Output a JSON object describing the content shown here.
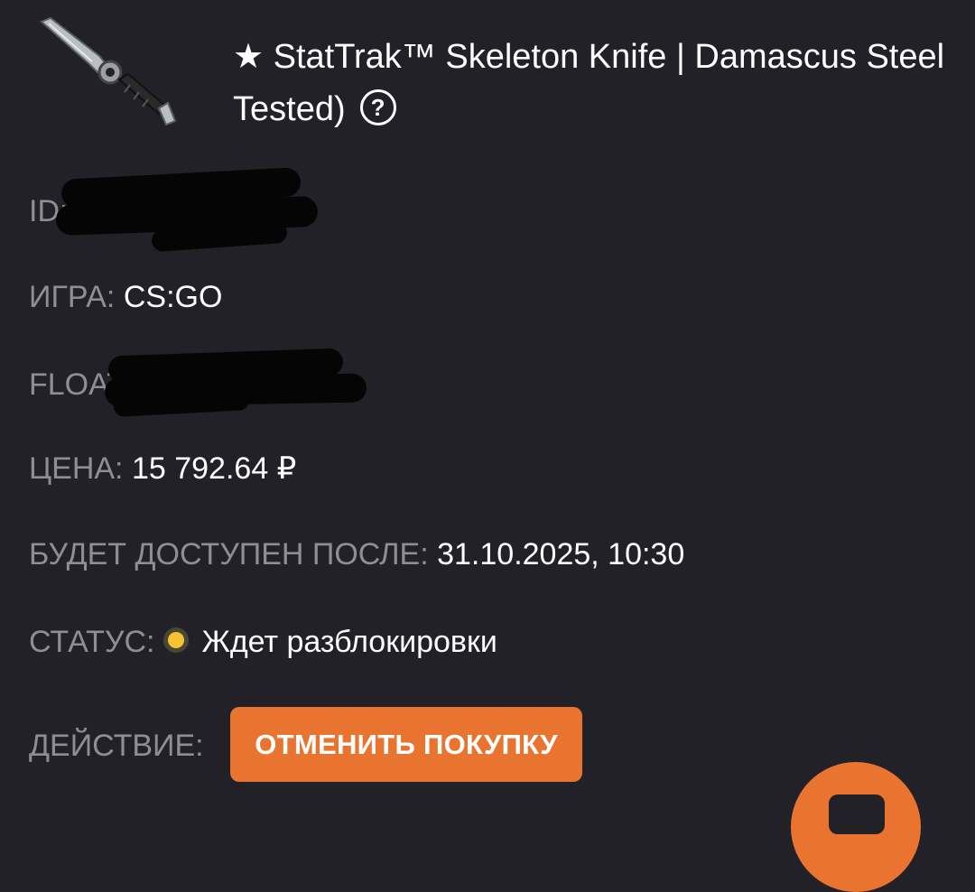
{
  "item": {
    "title_line1": "★ StatTrak™ Skeleton Knife | Damascus Steel",
    "title_line2": "Tested)",
    "help_icon_glyph": "?",
    "image_icon": "knife-image"
  },
  "details": {
    "id_label": "ID:",
    "game_label": "ИГРА:",
    "game_value": "CS:GO",
    "float_label": "FLOAT:",
    "price_label": "ЦЕНА:",
    "price_value": "15 792.64 ₽",
    "available_label": "БУДЕТ ДОСТУПЕН ПОСЛЕ:",
    "available_value": "31.10.2025, 10:30",
    "status_label": "СТАТУС:",
    "status_value": "Ждет разблокировки",
    "status_color": "#f6c232",
    "action_label": "ДЕЙСТВИЕ:",
    "action_button": "ОТМЕНИТЬ ПОКУПКУ"
  },
  "colors": {
    "background": "#212127",
    "accent": "#e8742f",
    "label": "#8e8e94"
  }
}
